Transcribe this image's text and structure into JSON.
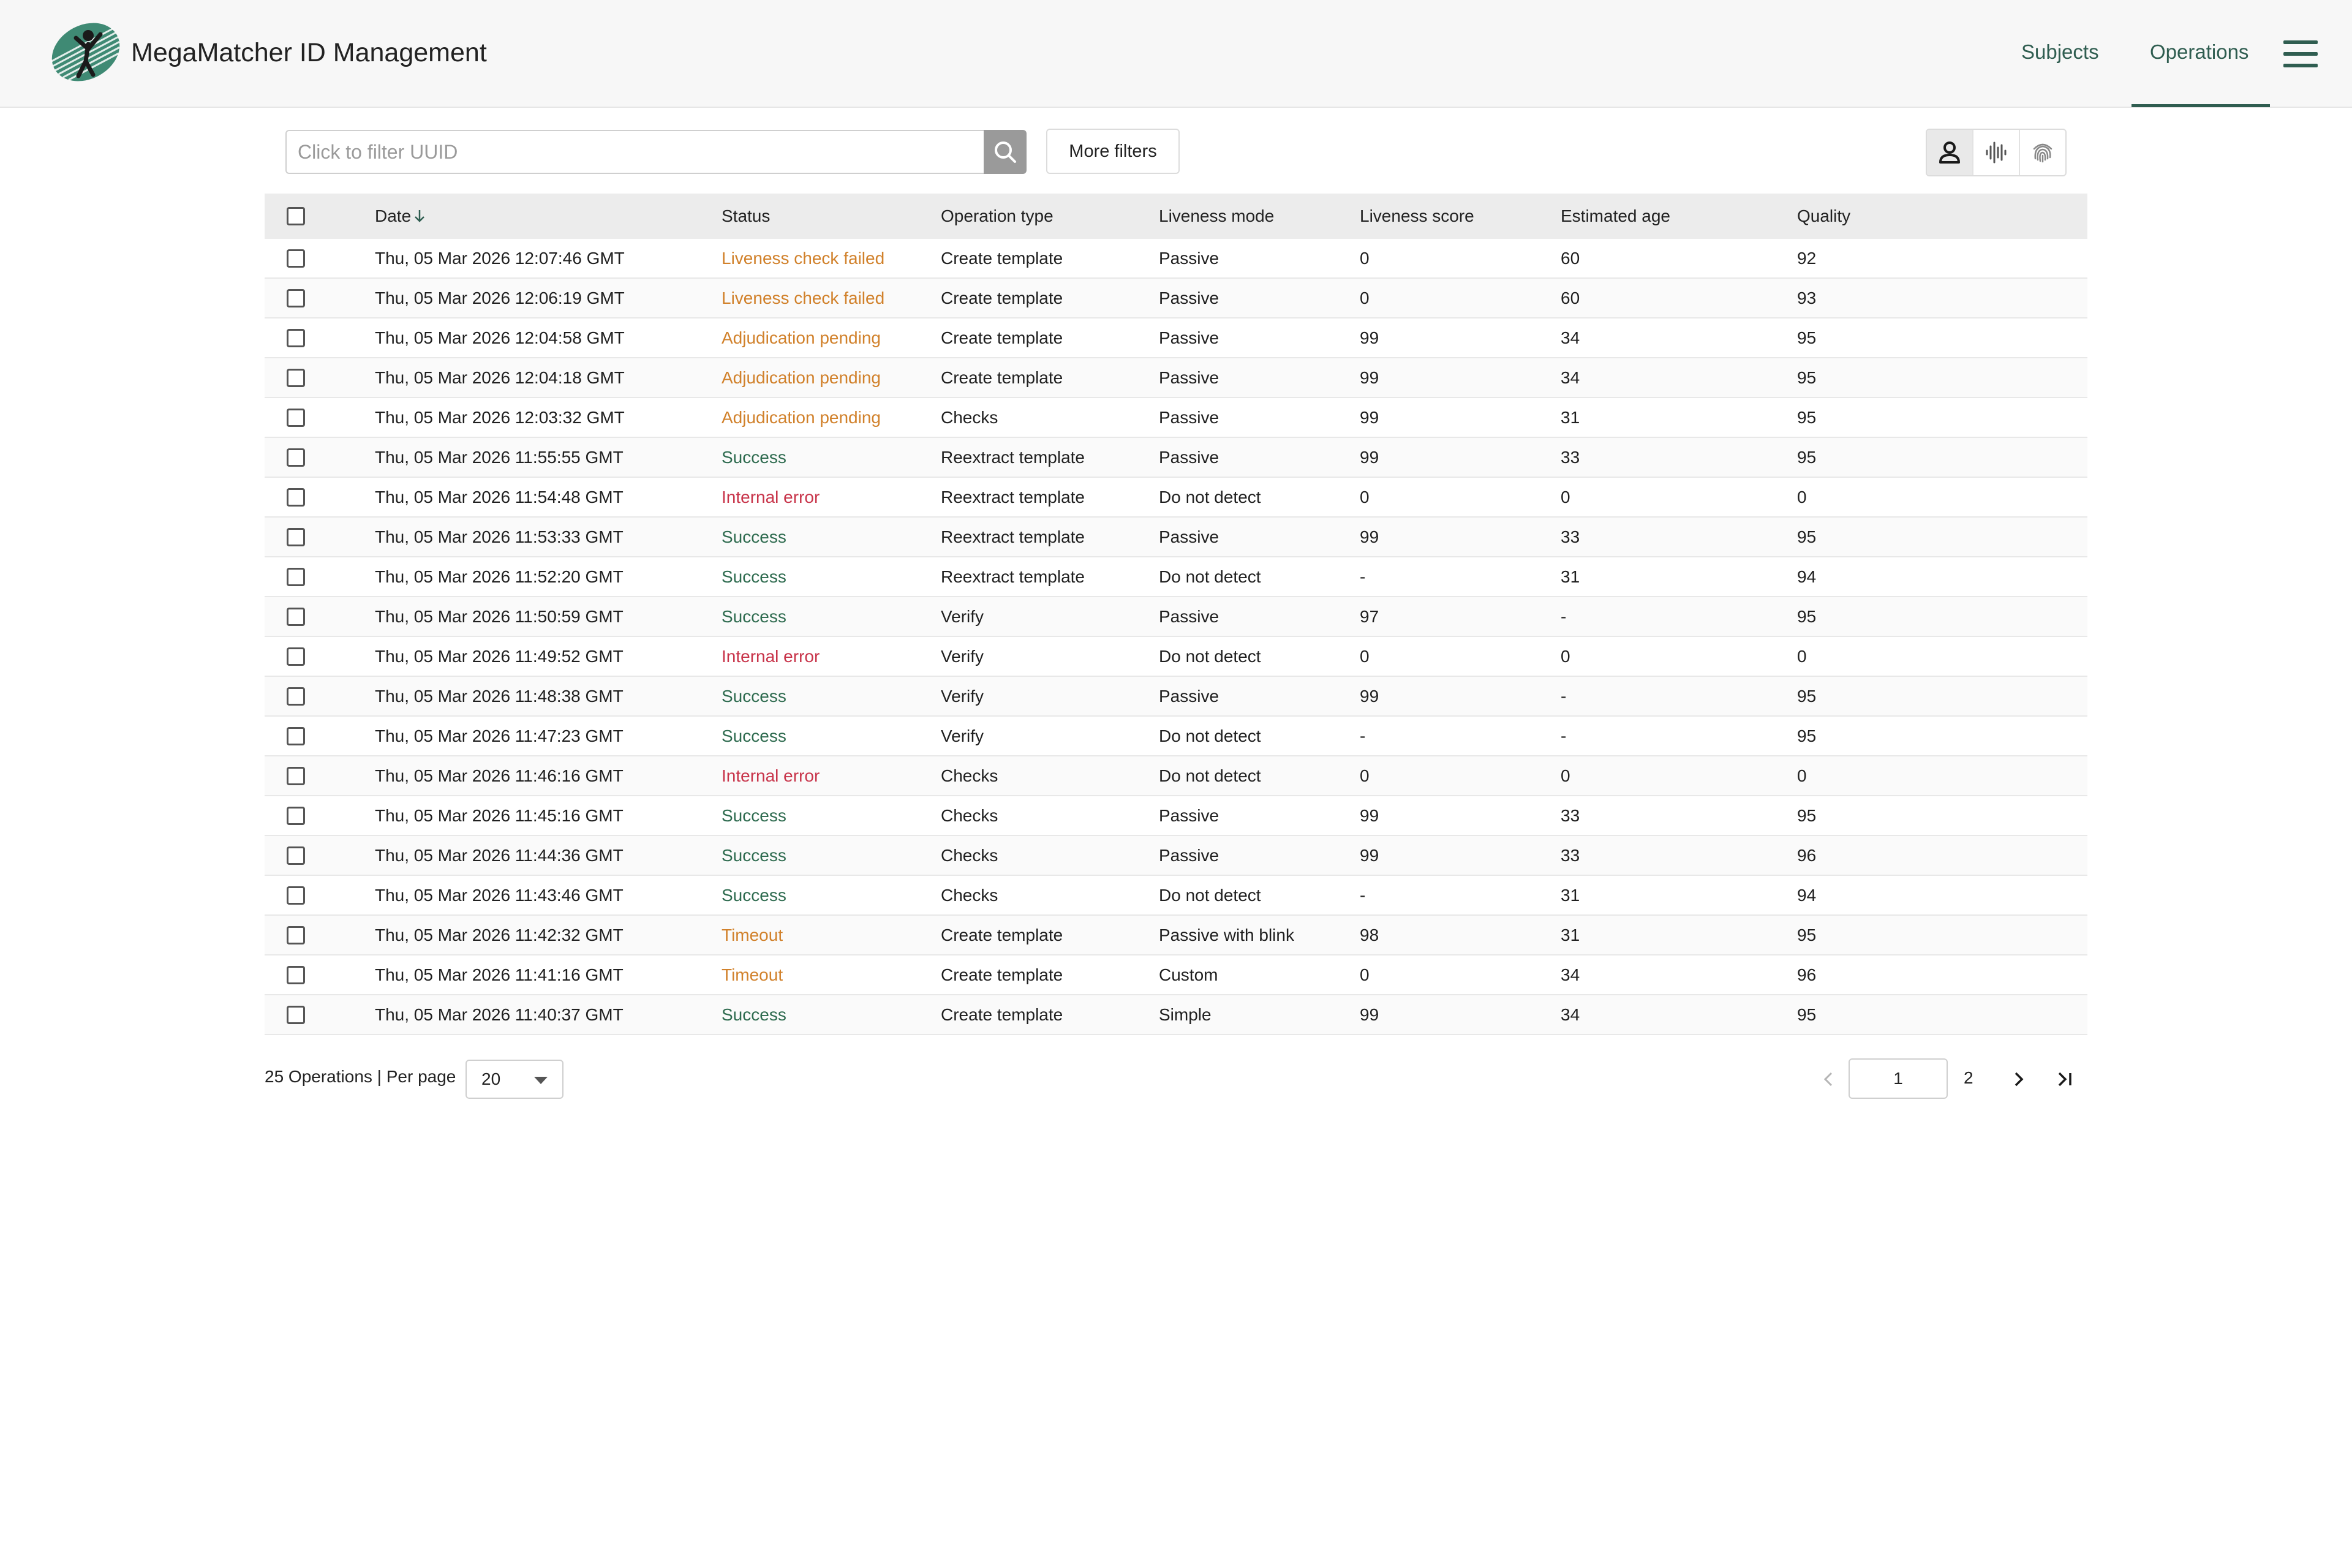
{
  "header": {
    "title": "MegaMatcher ID Management",
    "nav": [
      {
        "label": "Subjects"
      },
      {
        "label": "Operations"
      }
    ],
    "colors": {
      "accent": "#2f5d50",
      "logo": "#3f8a74"
    }
  },
  "toolbar": {
    "filter_placeholder": "Click to filter UUID",
    "more_filters_label": "More filters",
    "modalities": [
      "face-icon",
      "voice-icon",
      "fingerprint-icon"
    ],
    "active_modality": "face-icon"
  },
  "table": {
    "columns": {
      "date": "Date",
      "status": "Status",
      "operation_type": "Operation type",
      "liveness_mode": "Liveness mode",
      "liveness_score": "Liveness score",
      "estimated_age": "Estimated age",
      "quality": "Quality"
    },
    "rows": [
      {
        "date": "Thu, 05 Mar 2026 12:07:46 GMT",
        "status": "Liveness check failed",
        "op": "Create template",
        "mode": "Passive",
        "score": "0",
        "age": "60",
        "quality": "92"
      },
      {
        "date": "Thu, 05 Mar 2026 12:06:19 GMT",
        "status": "Liveness check failed",
        "op": "Create template",
        "mode": "Passive",
        "score": "0",
        "age": "60",
        "quality": "93"
      },
      {
        "date": "Thu, 05 Mar 2026 12:04:58 GMT",
        "status": "Adjudication pending",
        "op": "Create template",
        "mode": "Passive",
        "score": "99",
        "age": "34",
        "quality": "95"
      },
      {
        "date": "Thu, 05 Mar 2026 12:04:18 GMT",
        "status": "Adjudication pending",
        "op": "Create template",
        "mode": "Passive",
        "score": "99",
        "age": "34",
        "quality": "95"
      },
      {
        "date": "Thu, 05 Mar 2026 12:03:32 GMT",
        "status": "Adjudication pending",
        "op": "Checks",
        "mode": "Passive",
        "score": "99",
        "age": "31",
        "quality": "95"
      },
      {
        "date": "Thu, 05 Mar 2026 11:55:55 GMT",
        "status": "Success",
        "op": "Reextract template",
        "mode": "Passive",
        "score": "99",
        "age": "33",
        "quality": "95"
      },
      {
        "date": "Thu, 05 Mar 2026 11:54:48 GMT",
        "status": "Internal error",
        "op": "Reextract template",
        "mode": "Do not detect",
        "score": "0",
        "age": "0",
        "quality": "0"
      },
      {
        "date": "Thu, 05 Mar 2026 11:53:33 GMT",
        "status": "Success",
        "op": "Reextract template",
        "mode": "Passive",
        "score": "99",
        "age": "33",
        "quality": "95"
      },
      {
        "date": "Thu, 05 Mar 2026 11:52:20 GMT",
        "status": "Success",
        "op": "Reextract template",
        "mode": "Do not detect",
        "score": "-",
        "age": "31",
        "quality": "94"
      },
      {
        "date": "Thu, 05 Mar 2026 11:50:59 GMT",
        "status": "Success",
        "op": "Verify",
        "mode": "Passive",
        "score": "97",
        "age": "-",
        "quality": "95"
      },
      {
        "date": "Thu, 05 Mar 2026 11:49:52 GMT",
        "status": "Internal error",
        "op": "Verify",
        "mode": "Do not detect",
        "score": "0",
        "age": "0",
        "quality": "0"
      },
      {
        "date": "Thu, 05 Mar 2026 11:48:38 GMT",
        "status": "Success",
        "op": "Verify",
        "mode": "Passive",
        "score": "99",
        "age": "-",
        "quality": "95"
      },
      {
        "date": "Thu, 05 Mar 2026 11:47:23 GMT",
        "status": "Success",
        "op": "Verify",
        "mode": "Do not detect",
        "score": "-",
        "age": "-",
        "quality": "95"
      },
      {
        "date": "Thu, 05 Mar 2026 11:46:16 GMT",
        "status": "Internal error",
        "op": "Checks",
        "mode": "Do not detect",
        "score": "0",
        "age": "0",
        "quality": "0"
      },
      {
        "date": "Thu, 05 Mar 2026 11:45:16 GMT",
        "status": "Success",
        "op": "Checks",
        "mode": "Passive",
        "score": "99",
        "age": "33",
        "quality": "95"
      },
      {
        "date": "Thu, 05 Mar 2026 11:44:36 GMT",
        "status": "Success",
        "op": "Checks",
        "mode": "Passive",
        "score": "99",
        "age": "33",
        "quality": "96"
      },
      {
        "date": "Thu, 05 Mar 2026 11:43:46 GMT",
        "status": "Success",
        "op": "Checks",
        "mode": "Do not detect",
        "score": "-",
        "age": "31",
        "quality": "94"
      },
      {
        "date": "Thu, 05 Mar 2026 11:42:32 GMT",
        "status": "Timeout",
        "op": "Create template",
        "mode": "Passive with blink",
        "score": "98",
        "age": "31",
        "quality": "95"
      },
      {
        "date": "Thu, 05 Mar 2026 11:41:16 GMT",
        "status": "Timeout",
        "op": "Create template",
        "mode": "Custom",
        "score": "0",
        "age": "34",
        "quality": "96"
      },
      {
        "date": "Thu, 05 Mar 2026 11:40:37 GMT",
        "status": "Success",
        "op": "Create template",
        "mode": "Simple",
        "score": "99",
        "age": "34",
        "quality": "95"
      }
    ],
    "status_colors": {
      "Success": "#2e6b4f",
      "Liveness check failed": "#d1812b",
      "Adjudication pending": "#d1812b",
      "Timeout": "#d1812b",
      "Internal error": "#c8344a"
    }
  },
  "footer": {
    "count_text": "25 Operations | Per page",
    "per_page": "20",
    "current_page": "1",
    "next_page": "2"
  }
}
